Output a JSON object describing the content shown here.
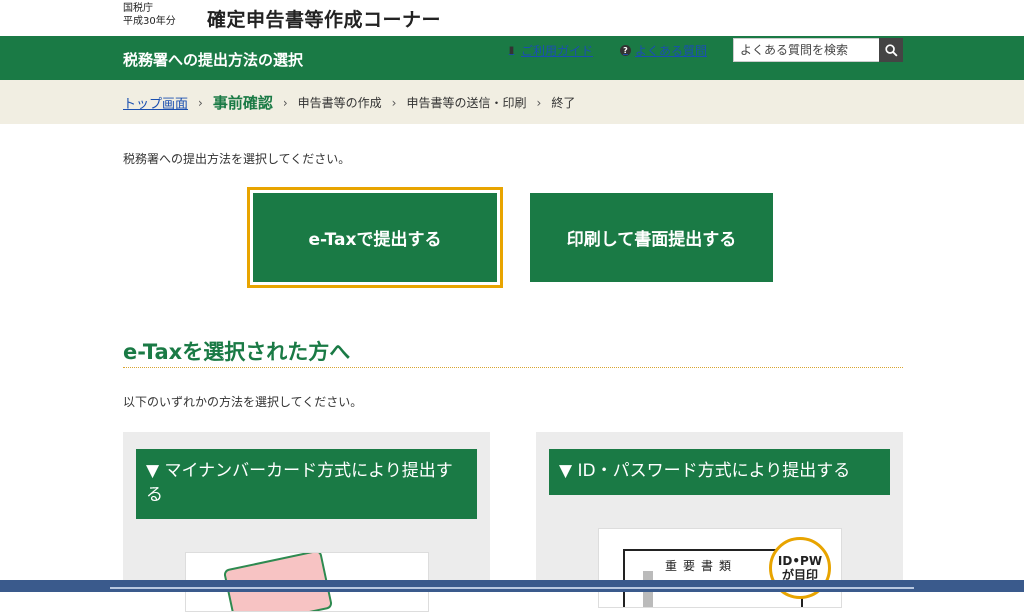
{
  "header": {
    "org_line1": "国税庁",
    "org_line2": "平成30年分",
    "app_title": "確定申告書等作成コーナー"
  },
  "green_bar": {
    "page_heading": "税務署への提出方法の選択",
    "guide_link": "ご利用ガイド",
    "faq_link": "よくある質問",
    "search_placeholder": "よくある質問を検索",
    "guide_icon": "book-icon",
    "faq_icon": "question-icon",
    "search_icon": "search-icon"
  },
  "breadcrumb": {
    "items": [
      {
        "label": "トップ画面",
        "state": "link"
      },
      {
        "label": "事前確認",
        "state": "current"
      },
      {
        "label": "申告書等の作成",
        "state": "future"
      },
      {
        "label": "申告書等の送信・印刷",
        "state": "future"
      },
      {
        "label": "終了",
        "state": "future"
      }
    ],
    "separator": "›"
  },
  "main": {
    "intro": "税務署への提出方法を選択してください。",
    "choices": {
      "etax": "e-Taxで提出する",
      "paper": "印刷して書面提出する"
    },
    "section_title": "e-Taxを選択された方へ",
    "sub_intro": "以下のいずれかの方法を選択してください。",
    "panels": {
      "mynumber": "▼ マイナンバーカード方式により提出する",
      "idpw": "▼ ID・パスワード方式により提出する"
    },
    "doc_title": "重要書類",
    "badge_line1": "ID•PW",
    "badge_line2": "が目印"
  },
  "colors": {
    "brand_green": "#1a7a45",
    "focus_outline": "#e8a400",
    "crumb_bg": "#f1eee2",
    "link_blue": "#1a4fb0"
  }
}
